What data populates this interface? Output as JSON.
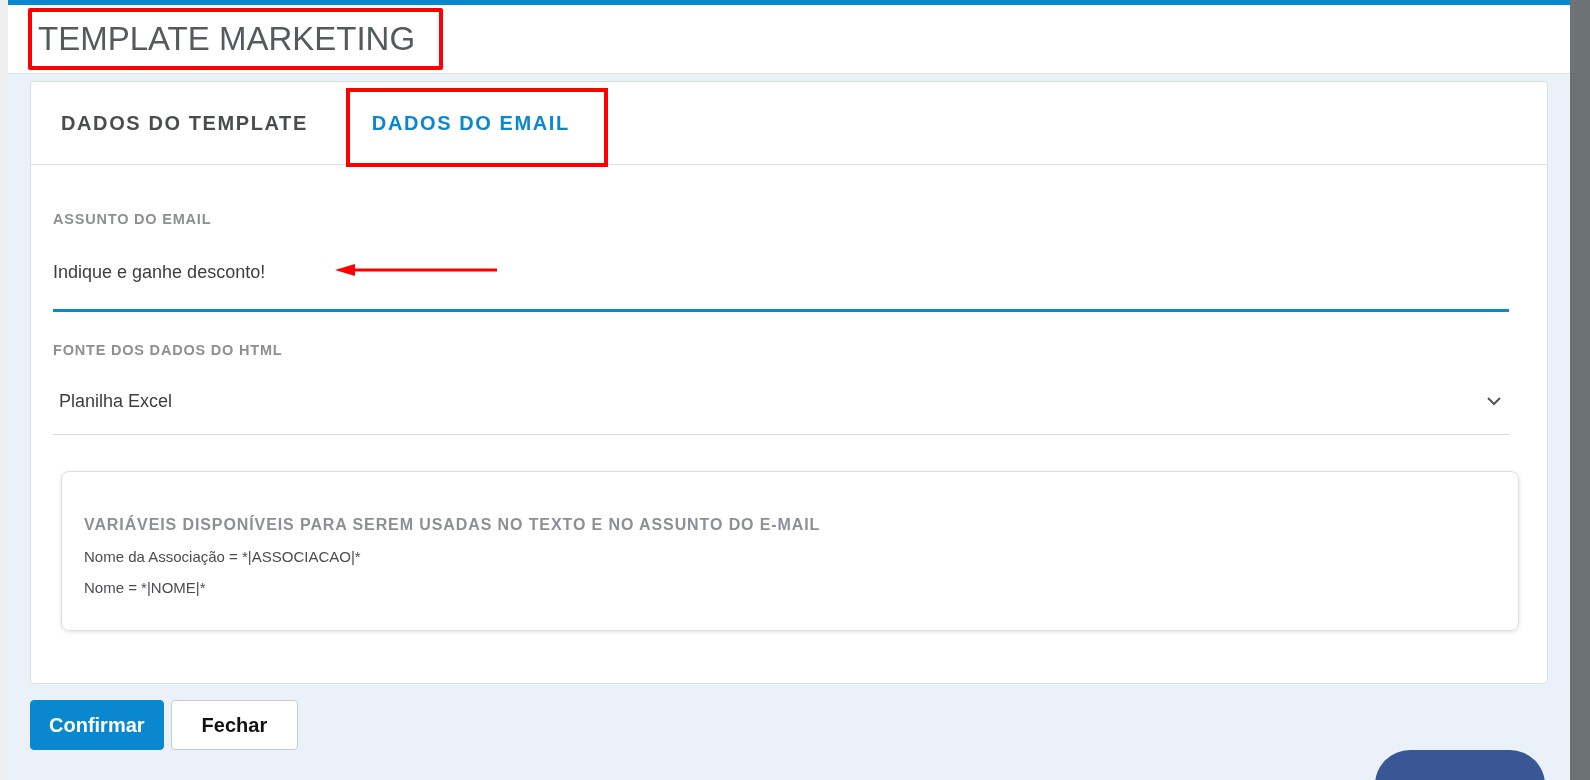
{
  "header": {
    "title": "TEMPLATE MARKETING",
    "highlighted": true
  },
  "tabs": [
    {
      "label": "DADOS DO TEMPLATE",
      "selected": false,
      "highlighted": false
    },
    {
      "label": "DADOS DO EMAIL",
      "selected": true,
      "highlighted": true
    }
  ],
  "subject": {
    "label": "ASSUNTO DO EMAIL",
    "value": "Indique e ganhe desconto!",
    "focused": true,
    "arrow": true
  },
  "source": {
    "label": "FONTE DOS DADOS DO HTML",
    "value": "Planilha Excel"
  },
  "variables": {
    "title": "VARIÁVEIS DISPONÍVEIS PARA SEREM USADAS NO TEXTO E NO ASSUNTO DO E-MAIL",
    "items": [
      "Nome da Associação = *|ASSOCIACAO|*",
      "Nome = *|NOME|*"
    ]
  },
  "buttons": [
    {
      "label": "Confirmar",
      "kind": "primary"
    },
    {
      "label": "Fechar",
      "kind": "secondary"
    }
  ]
}
